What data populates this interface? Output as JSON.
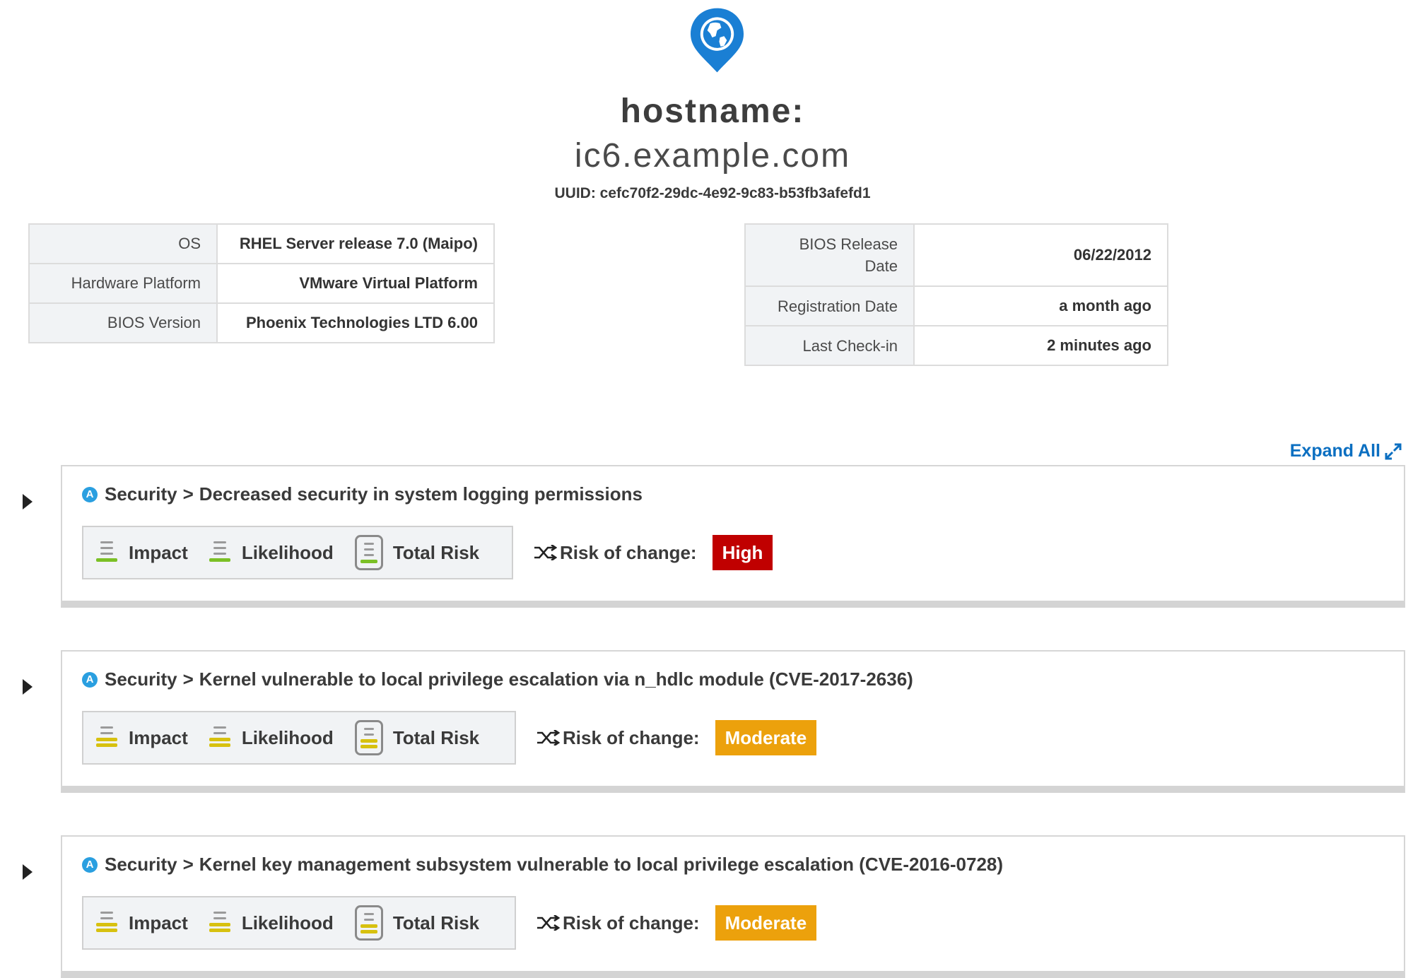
{
  "header": {
    "hostname_label": "hostname:",
    "hostname_value": "ic6.example.com",
    "uuid": "UUID: cefc70f2-29dc-4e92-9c83-b53fb3afefd1",
    "icon": "globe-pin-icon"
  },
  "system_info_left": [
    {
      "key": "OS",
      "value": "RHEL Server release 7.0 (Maipo)"
    },
    {
      "key": "Hardware Platform",
      "value": "VMware Virtual Platform"
    },
    {
      "key": "BIOS Version",
      "value": "Phoenix Technologies LTD 6.00"
    }
  ],
  "system_info_right": [
    {
      "key_line1": "BIOS Release",
      "key_line2": "Date",
      "value": "06/22/2012"
    },
    {
      "key": "Registration Date",
      "value": "a month ago"
    },
    {
      "key": "Last Check-in",
      "value": "2 minutes ago"
    }
  ],
  "expand_all": {
    "label": "Expand All",
    "icon": "expand-arrows-icon"
  },
  "rules": [
    {
      "badge": "A",
      "category": "Security",
      "separator": ">",
      "title": "Decreased security in system logging permissions",
      "impact_label": "Impact",
      "likelihood_label": "Likelihood",
      "total_risk_label": "Total Risk",
      "risk_change_label": "Risk of change:",
      "risk_change_value": "High",
      "risk_change_color": "#c00000",
      "meter_color": "#7bc026",
      "meter_level": 1
    },
    {
      "badge": "A",
      "category": "Security",
      "separator": ">",
      "title": "Kernel vulnerable to local privilege escalation via n_hdlc module (CVE-2017-2636)",
      "impact_label": "Impact",
      "likelihood_label": "Likelihood",
      "total_risk_label": "Total Risk",
      "risk_change_label": "Risk of change:",
      "risk_change_value": "Moderate",
      "risk_change_color": "#eca10c",
      "meter_color": "#d7c10f",
      "meter_level": 2
    },
    {
      "badge": "A",
      "category": "Security",
      "separator": ">",
      "title": "Kernel key management subsystem vulnerable to local privilege escalation (CVE-2016-0728)",
      "impact_label": "Impact",
      "likelihood_label": "Likelihood",
      "total_risk_label": "Total Risk",
      "risk_change_label": "Risk of change:",
      "risk_change_value": "Moderate",
      "risk_change_color": "#eca10c",
      "meter_color": "#d7c10f",
      "meter_level": 2
    }
  ]
}
